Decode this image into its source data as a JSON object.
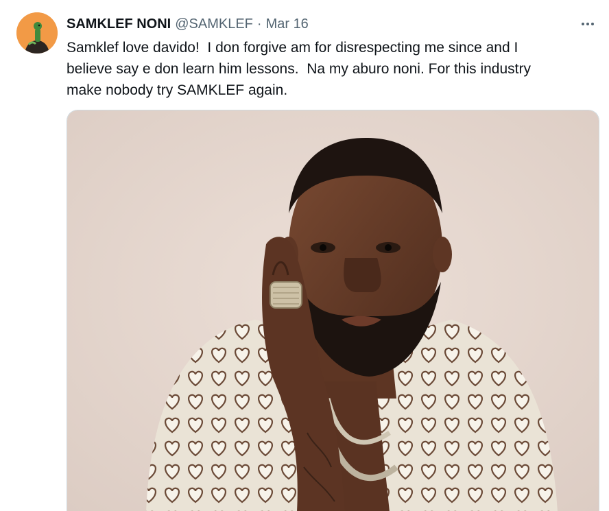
{
  "tweet": {
    "display_name": "SAMKLEF NONI",
    "handle": "@SAMKLEF",
    "separator": "·",
    "timestamp": "Mar 16",
    "more_icon": "more-horizontal-icon",
    "text": "Samklef love davido!  I don forgive am for disrespecting me since and I\nbelieve say e don learn him lessons.  Na my aburo noni. For this industry\nmake nobody try SAMKLEF again.",
    "avatar_bg": "#f29a46",
    "media": {
      "kind": "photo",
      "background_color": "#e4d5cd"
    }
  },
  "colors": {
    "primary_text": "#0f1419",
    "secondary_text": "#536471",
    "border": "#cfd9de"
  }
}
